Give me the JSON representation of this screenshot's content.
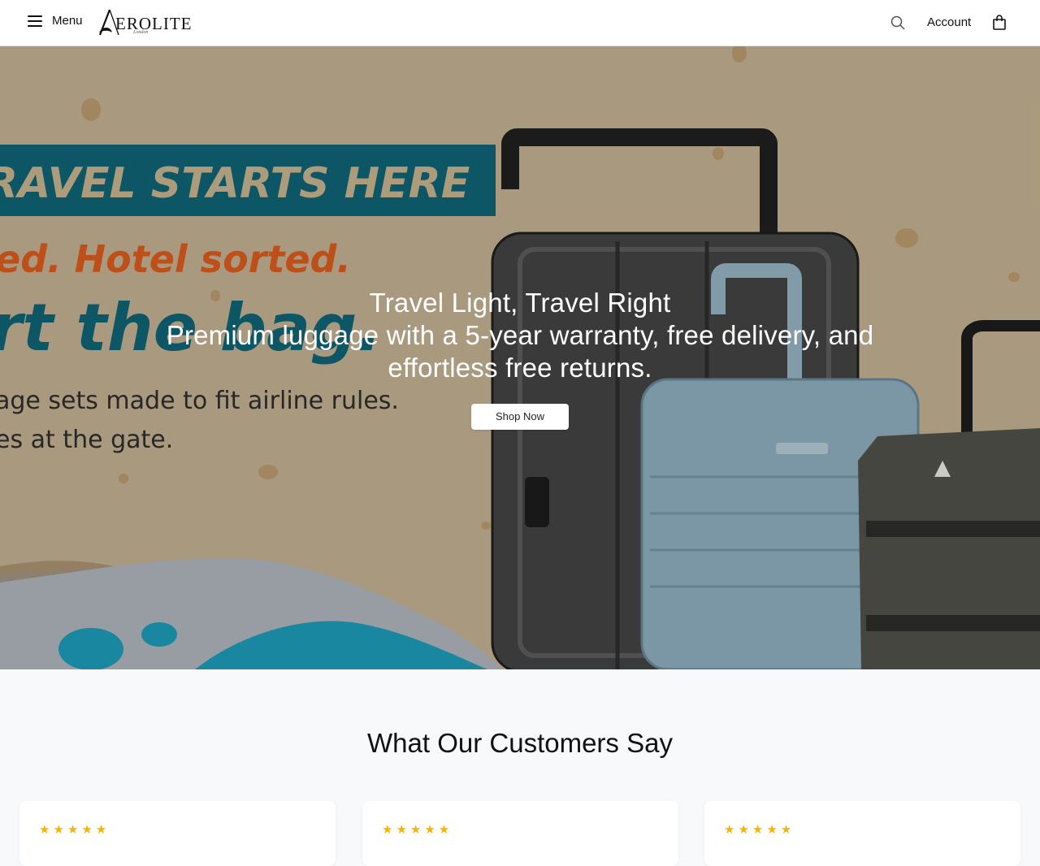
{
  "header": {
    "menu_label": "Menu",
    "logo_text": "EROLITE",
    "logo_sub": "London",
    "account_label": "Account",
    "icons": {
      "menu": "hamburger-icon",
      "search": "search-icon",
      "cart": "shopping-bag-icon"
    }
  },
  "hero": {
    "title": "Travel Light, Travel Right",
    "subtitle": "Premium luggage with a 5-year warranty, free delivery, and effortless free returns.",
    "cta_label": "Shop Now",
    "art_text": {
      "line1": "RAVEL STARTS HERE",
      "line2": "ed. Hotel sorted.",
      "line3": "rt the bag.",
      "line4": "age sets made to fit airline rules.",
      "line5": "es at the gate."
    }
  },
  "reviews": {
    "title": "What Our Customers Say",
    "cards": [
      {
        "stars": "★★★★★",
        "rating": 5
      },
      {
        "stars": "★★★★★",
        "rating": 5
      },
      {
        "stars": "★★★★★",
        "rating": 5
      }
    ]
  },
  "colors": {
    "accent_teal": "#0d5b6b",
    "accent_orange": "#c9541a",
    "star": "#f4b400",
    "hero_bg": "#b3a285"
  }
}
